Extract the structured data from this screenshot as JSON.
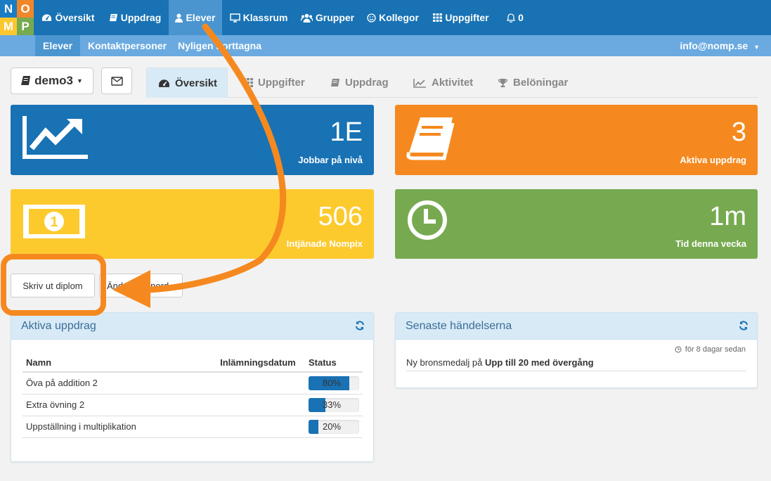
{
  "logo": {
    "letters": [
      "N",
      "O",
      "M",
      "P"
    ],
    "colors": [
      "#1a7dc4",
      "#f0862a",
      "#fcc72e",
      "#77aa50"
    ]
  },
  "nav": {
    "items": [
      {
        "label": "Översikt",
        "icon": "dashboard-icon"
      },
      {
        "label": "Uppdrag",
        "icon": "book-icon"
      },
      {
        "label": "Elever",
        "icon": "user-icon"
      },
      {
        "label": "Klassrum",
        "icon": "monitor-icon"
      },
      {
        "label": "Grupper",
        "icon": "users-icon"
      },
      {
        "label": "Kollegor",
        "icon": "smile-icon"
      },
      {
        "label": "Uppgifter",
        "icon": "grid-icon"
      },
      {
        "label": "0",
        "icon": "bell-icon"
      }
    ],
    "active": "Elever"
  },
  "subnav": {
    "items": [
      "Elever",
      "Kontaktpersoner",
      "Nyligen borttagna"
    ],
    "active": "Elever",
    "user": "info@nomp.se"
  },
  "student": {
    "name": "demo3"
  },
  "tabs": [
    {
      "label": "Översikt",
      "icon": "dashboard-icon",
      "active": true
    },
    {
      "label": "Uppgifter",
      "icon": "grid-icon",
      "active": false
    },
    {
      "label": "Uppdrag",
      "icon": "book-icon",
      "active": false
    },
    {
      "label": "Aktivitet",
      "icon": "line-chart-icon",
      "active": false
    },
    {
      "label": "Belöningar",
      "icon": "trophy-icon",
      "active": false
    }
  ],
  "stats": {
    "level": {
      "value": "1E",
      "label": "Jobbar på nivå",
      "color": "#1872b4"
    },
    "missions": {
      "value": "3",
      "label": "Aktiva uppdrag",
      "color": "#f5891f"
    },
    "nompix": {
      "value": "506",
      "label": "Intjänade Nompix",
      "color": "#fdca2e"
    },
    "time": {
      "value": "1m",
      "label": "Tid denna vecka",
      "color": "#77aa50"
    }
  },
  "actions": {
    "print_diploma": "Skriv ut diplom",
    "change_password": "Ändra lösenord"
  },
  "active_missions": {
    "title": "Aktiva uppdrag",
    "columns": [
      "Namn",
      "Inlämningsdatum",
      "Status"
    ],
    "rows": [
      {
        "name": "Öva på addition 2",
        "due": "",
        "status": "80%",
        "progress": 0.8
      },
      {
        "name": "Extra övning 2",
        "due": "",
        "status": "33%",
        "progress": 0.33
      },
      {
        "name": "Uppställning i multiplikation",
        "due": "",
        "status": "20%",
        "progress": 0.2
      }
    ]
  },
  "recent_events": {
    "title": "Senaste händelserna",
    "items": [
      {
        "time": "för 8 dagar sedan",
        "text_prefix": "Ny bronsmedalj på",
        "text_bold": "Upp till 20 med övergång"
      }
    ]
  },
  "annotation_color": "#f5891f"
}
